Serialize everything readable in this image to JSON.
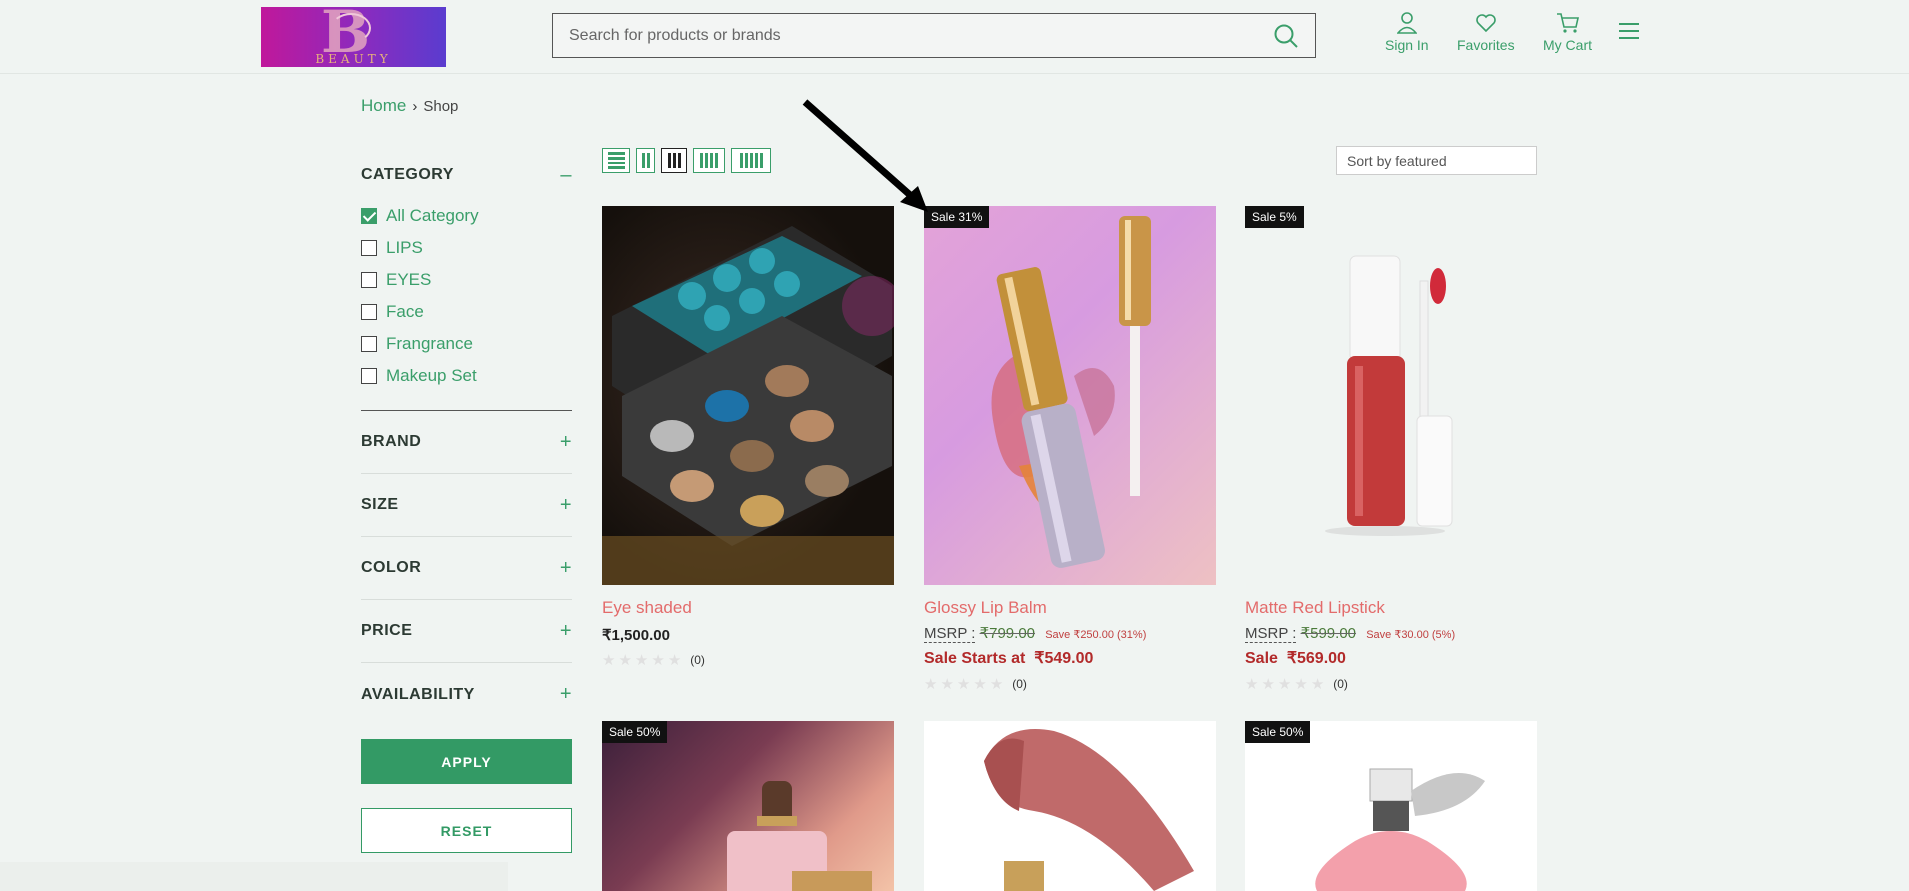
{
  "header": {
    "logo_text": "BEAUTY",
    "search_placeholder": "Search for products or brands",
    "links": {
      "sign_in": "Sign In",
      "favorites": "Favorites",
      "cart": "My Cart"
    }
  },
  "breadcrumb": {
    "home": "Home",
    "separator": "›",
    "current": "Shop"
  },
  "sidebar": {
    "category_title": "CATEGORY",
    "category_toggle": "–",
    "categories": [
      {
        "label": "All Category",
        "checked": true
      },
      {
        "label": "LIPS",
        "checked": false
      },
      {
        "label": "EYES",
        "checked": false
      },
      {
        "label": "Face",
        "checked": false
      },
      {
        "label": "Frangrance",
        "checked": false
      },
      {
        "label": "Makeup Set",
        "checked": false
      }
    ],
    "sections": [
      {
        "title": "BRAND",
        "toggle": "+"
      },
      {
        "title": "SIZE",
        "toggle": "+"
      },
      {
        "title": "COLOR",
        "toggle": "+"
      },
      {
        "title": "PRICE",
        "toggle": "+"
      },
      {
        "title": "AVAILABILITY",
        "toggle": "+"
      }
    ],
    "apply_label": "APPLY",
    "reset_label": "RESET"
  },
  "toolbar": {
    "sort_label": "Sort by featured"
  },
  "products": [
    {
      "name": "Eye shaded",
      "price": "₹1,500.00",
      "rating_count": "(0)"
    },
    {
      "badge": "Sale 31%",
      "name": "Glossy Lip Balm",
      "msrp_label": "MSRP :",
      "msrp": "₹799.00",
      "save": "Save ₹250.00 (31%)",
      "sale_label": "Sale Starts at",
      "sale_price": "₹549.00",
      "rating_count": "(0)"
    },
    {
      "badge": "Sale 5%",
      "name": "Matte Red Lipstick",
      "msrp_label": "MSRP :",
      "msrp": "₹599.00",
      "save": "Save ₹30.00 (5%)",
      "sale_label": "Sale",
      "sale_price": "₹569.00",
      "rating_count": "(0)"
    },
    {
      "badge": "Sale 50%"
    },
    {},
    {
      "badge": "Sale 50%"
    }
  ],
  "colors": {
    "accent": "#339a65",
    "product_name": "#e36b6b",
    "sale": "#b22a2a"
  }
}
